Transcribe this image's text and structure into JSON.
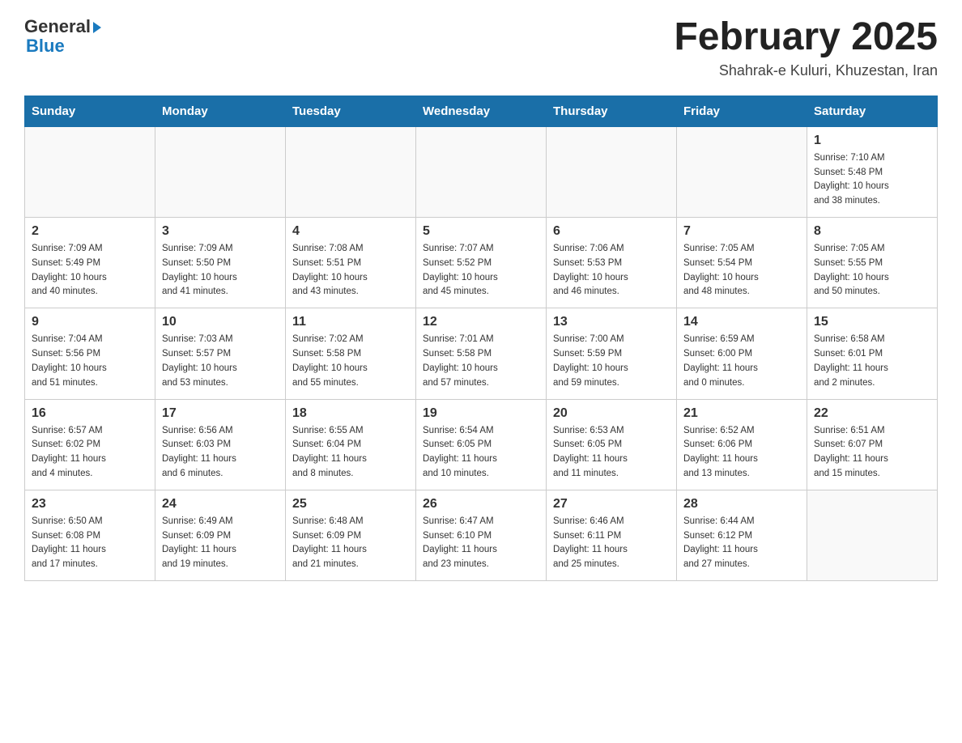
{
  "header": {
    "logo_general": "General",
    "logo_blue": "Blue",
    "title": "February 2025",
    "location": "Shahrak-e Kuluri, Khuzestan, Iran"
  },
  "weekdays": [
    "Sunday",
    "Monday",
    "Tuesday",
    "Wednesday",
    "Thursday",
    "Friday",
    "Saturday"
  ],
  "weeks": [
    [
      {
        "day": "",
        "info": ""
      },
      {
        "day": "",
        "info": ""
      },
      {
        "day": "",
        "info": ""
      },
      {
        "day": "",
        "info": ""
      },
      {
        "day": "",
        "info": ""
      },
      {
        "day": "",
        "info": ""
      },
      {
        "day": "1",
        "info": "Sunrise: 7:10 AM\nSunset: 5:48 PM\nDaylight: 10 hours\nand 38 minutes."
      }
    ],
    [
      {
        "day": "2",
        "info": "Sunrise: 7:09 AM\nSunset: 5:49 PM\nDaylight: 10 hours\nand 40 minutes."
      },
      {
        "day": "3",
        "info": "Sunrise: 7:09 AM\nSunset: 5:50 PM\nDaylight: 10 hours\nand 41 minutes."
      },
      {
        "day": "4",
        "info": "Sunrise: 7:08 AM\nSunset: 5:51 PM\nDaylight: 10 hours\nand 43 minutes."
      },
      {
        "day": "5",
        "info": "Sunrise: 7:07 AM\nSunset: 5:52 PM\nDaylight: 10 hours\nand 45 minutes."
      },
      {
        "day": "6",
        "info": "Sunrise: 7:06 AM\nSunset: 5:53 PM\nDaylight: 10 hours\nand 46 minutes."
      },
      {
        "day": "7",
        "info": "Sunrise: 7:05 AM\nSunset: 5:54 PM\nDaylight: 10 hours\nand 48 minutes."
      },
      {
        "day": "8",
        "info": "Sunrise: 7:05 AM\nSunset: 5:55 PM\nDaylight: 10 hours\nand 50 minutes."
      }
    ],
    [
      {
        "day": "9",
        "info": "Sunrise: 7:04 AM\nSunset: 5:56 PM\nDaylight: 10 hours\nand 51 minutes."
      },
      {
        "day": "10",
        "info": "Sunrise: 7:03 AM\nSunset: 5:57 PM\nDaylight: 10 hours\nand 53 minutes."
      },
      {
        "day": "11",
        "info": "Sunrise: 7:02 AM\nSunset: 5:58 PM\nDaylight: 10 hours\nand 55 minutes."
      },
      {
        "day": "12",
        "info": "Sunrise: 7:01 AM\nSunset: 5:58 PM\nDaylight: 10 hours\nand 57 minutes."
      },
      {
        "day": "13",
        "info": "Sunrise: 7:00 AM\nSunset: 5:59 PM\nDaylight: 10 hours\nand 59 minutes."
      },
      {
        "day": "14",
        "info": "Sunrise: 6:59 AM\nSunset: 6:00 PM\nDaylight: 11 hours\nand 0 minutes."
      },
      {
        "day": "15",
        "info": "Sunrise: 6:58 AM\nSunset: 6:01 PM\nDaylight: 11 hours\nand 2 minutes."
      }
    ],
    [
      {
        "day": "16",
        "info": "Sunrise: 6:57 AM\nSunset: 6:02 PM\nDaylight: 11 hours\nand 4 minutes."
      },
      {
        "day": "17",
        "info": "Sunrise: 6:56 AM\nSunset: 6:03 PM\nDaylight: 11 hours\nand 6 minutes."
      },
      {
        "day": "18",
        "info": "Sunrise: 6:55 AM\nSunset: 6:04 PM\nDaylight: 11 hours\nand 8 minutes."
      },
      {
        "day": "19",
        "info": "Sunrise: 6:54 AM\nSunset: 6:05 PM\nDaylight: 11 hours\nand 10 minutes."
      },
      {
        "day": "20",
        "info": "Sunrise: 6:53 AM\nSunset: 6:05 PM\nDaylight: 11 hours\nand 11 minutes."
      },
      {
        "day": "21",
        "info": "Sunrise: 6:52 AM\nSunset: 6:06 PM\nDaylight: 11 hours\nand 13 minutes."
      },
      {
        "day": "22",
        "info": "Sunrise: 6:51 AM\nSunset: 6:07 PM\nDaylight: 11 hours\nand 15 minutes."
      }
    ],
    [
      {
        "day": "23",
        "info": "Sunrise: 6:50 AM\nSunset: 6:08 PM\nDaylight: 11 hours\nand 17 minutes."
      },
      {
        "day": "24",
        "info": "Sunrise: 6:49 AM\nSunset: 6:09 PM\nDaylight: 11 hours\nand 19 minutes."
      },
      {
        "day": "25",
        "info": "Sunrise: 6:48 AM\nSunset: 6:09 PM\nDaylight: 11 hours\nand 21 minutes."
      },
      {
        "day": "26",
        "info": "Sunrise: 6:47 AM\nSunset: 6:10 PM\nDaylight: 11 hours\nand 23 minutes."
      },
      {
        "day": "27",
        "info": "Sunrise: 6:46 AM\nSunset: 6:11 PM\nDaylight: 11 hours\nand 25 minutes."
      },
      {
        "day": "28",
        "info": "Sunrise: 6:44 AM\nSunset: 6:12 PM\nDaylight: 11 hours\nand 27 minutes."
      },
      {
        "day": "",
        "info": ""
      }
    ]
  ]
}
